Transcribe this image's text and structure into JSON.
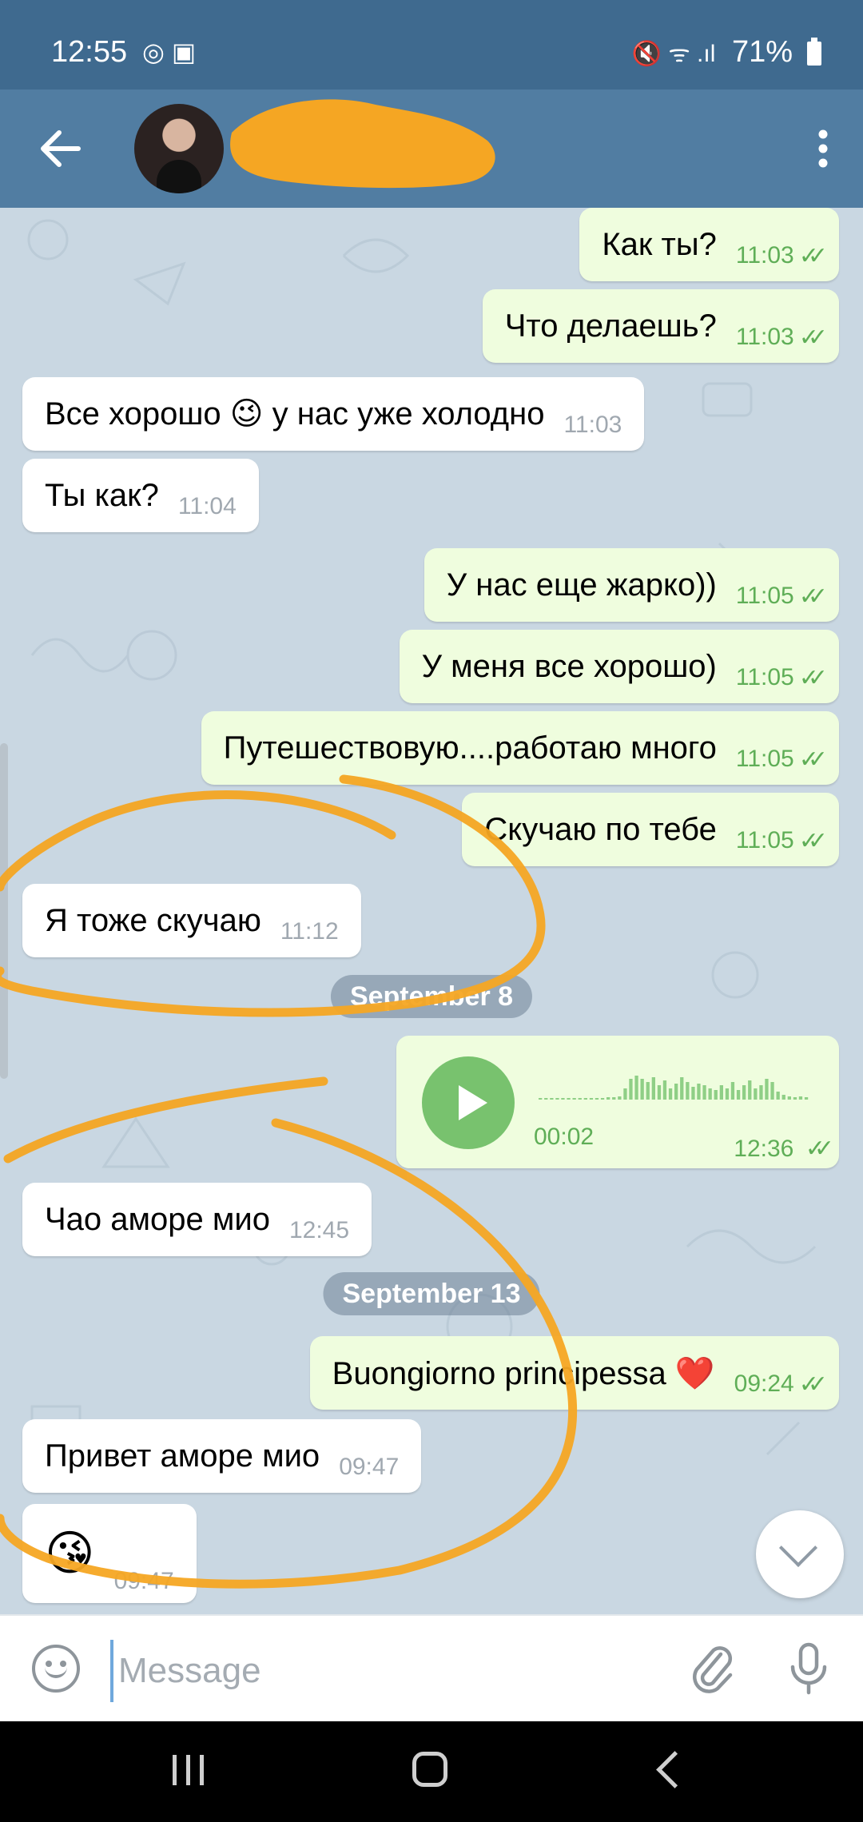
{
  "status_bar": {
    "time": "12:55",
    "battery": "71%"
  },
  "header": {
    "title": "",
    "subtitle": ""
  },
  "messages": [
    {
      "dir": "out",
      "text": "Как ты?",
      "time": "11:03"
    },
    {
      "dir": "out",
      "text": "Что делаешь?",
      "time": "11:03"
    },
    {
      "dir": "in",
      "text": "Все хорошо 😉 у нас уже холодно",
      "time": "11:03"
    },
    {
      "dir": "in",
      "text": "Ты как?",
      "time": "11:04"
    },
    {
      "dir": "out",
      "text": "У нас еще жарко))",
      "time": "11:05"
    },
    {
      "dir": "out",
      "text": "У меня все хорошо)",
      "time": "11:05"
    },
    {
      "dir": "out",
      "text": "Путешествовую....работаю много",
      "time": "11:05"
    },
    {
      "dir": "out",
      "text": "Скучаю по тебе",
      "time": "11:05"
    },
    {
      "dir": "in",
      "text": "Я тоже скучаю",
      "time": "11:12"
    },
    {
      "dir": "in",
      "text": "Чао аморе мио",
      "time": "12:45"
    },
    {
      "dir": "out",
      "text": "Buongiorno principessa ❤️",
      "time": "09:24"
    },
    {
      "dir": "in",
      "text": "Привет аморе мио",
      "time": "09:47"
    },
    {
      "dir": "in",
      "text": "😘",
      "time": "09:47"
    }
  ],
  "date_badges": [
    "September 8",
    "September 13"
  ],
  "voice_message": {
    "duration": "00:02",
    "time": "12:36"
  },
  "input": {
    "placeholder": "Message"
  },
  "icons": {
    "back": "arrow-left-icon",
    "menu": "more-vertical-icon",
    "emoji": "smile-icon",
    "attach": "paperclip-icon",
    "mic": "microphone-icon",
    "play": "play-icon",
    "scroll_down": "chevron-down-icon"
  },
  "colors": {
    "header": "#517da2",
    "status_bar": "#3f6a8f",
    "outgoing_bubble": "#effdde",
    "incoming_bubble": "#ffffff",
    "read_check": "#5fae57",
    "annotation": "#f5a623"
  }
}
